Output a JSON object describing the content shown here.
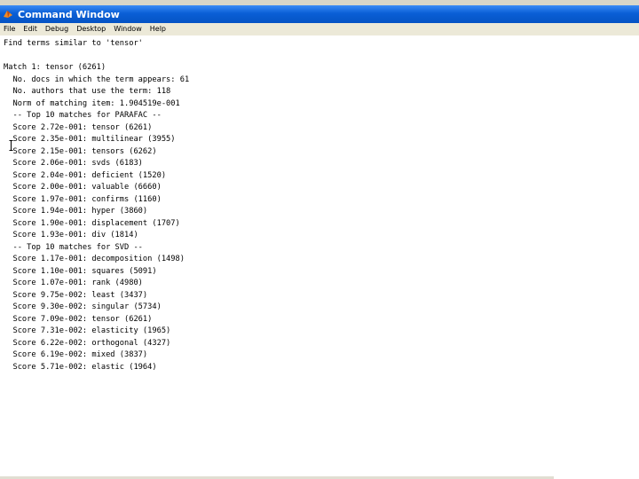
{
  "window": {
    "title": "Command Window",
    "accent_color": "#0a5fd6"
  },
  "menu": [
    {
      "label": "File"
    },
    {
      "label": "Edit"
    },
    {
      "label": "Debug"
    },
    {
      "label": "Desktop"
    },
    {
      "label": "Window"
    },
    {
      "label": "Help"
    }
  ],
  "console": {
    "lines": [
      "Find terms similar to 'tensor'",
      "",
      "Match 1: tensor (6261)",
      "  No. docs in which the term appears: 61",
      "  No. authors that use the term: 118",
      "  Norm of matching item: 1.904519e-001",
      "  -- Top 10 matches for PARAFAC --",
      "  Score 2.72e-001: tensor (6261)",
      "  Score 2.35e-001: multilinear (3955)",
      "  Score 2.15e-001: tensors (6262)",
      "  Score 2.06e-001: svds (6183)",
      "  Score 2.04e-001: deficient (1520)",
      "  Score 2.00e-001: valuable (6660)",
      "  Score 1.97e-001: confirms (1160)",
      "  Score 1.94e-001: hyper (3860)",
      "  Score 1.90e-001: displacement (1707)",
      "  Score 1.93e-001: div (1814)",
      "  -- Top 10 matches for SVD --",
      "  Score 1.17e-001: decomposition (1498)",
      "  Score 1.10e-001: squares (5091)",
      "  Score 1.07e-001: rank (4980)",
      "  Score 9.75e-002: least (3437)",
      "  Score 9.30e-002: singular (5734)",
      "  Score 7.09e-002: tensor (6261)",
      "  Score 7.31e-002: elasticity (1965)",
      "  Score 6.22e-002: orthogonal (4327)",
      "  Score 6.19e-002: mixed (3837)",
      "  Score 5.71e-002: elastic (1964)"
    ]
  }
}
